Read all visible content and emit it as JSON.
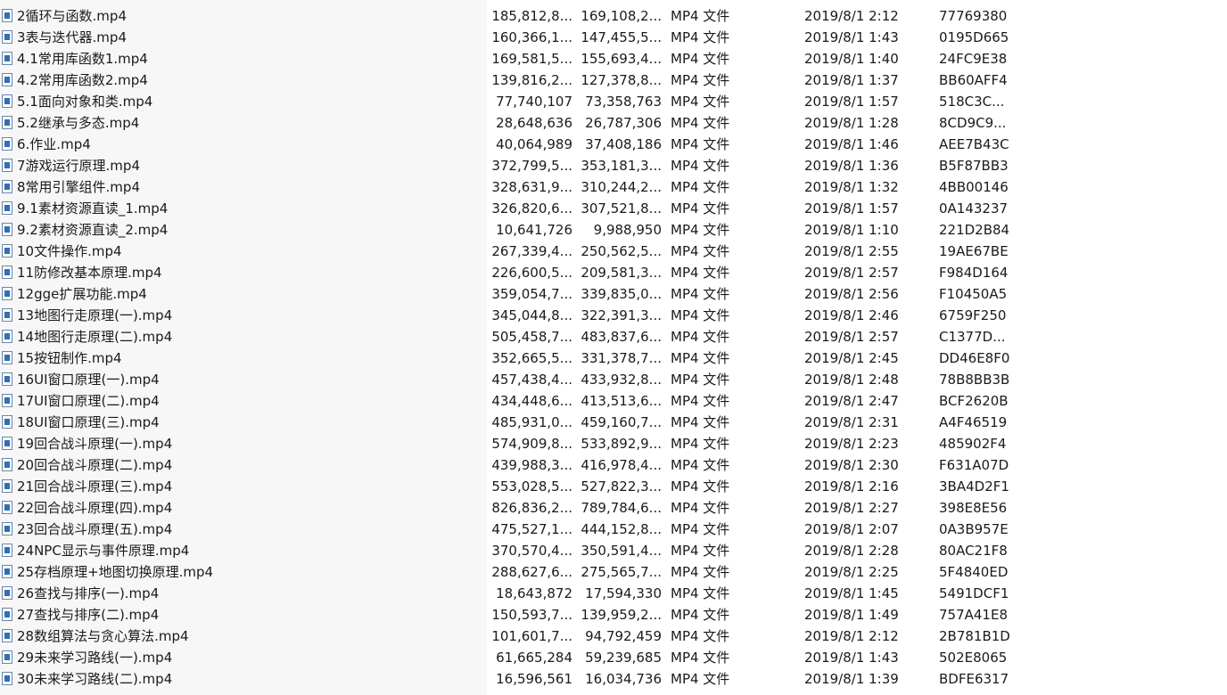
{
  "files": [
    {
      "name": "2循环与函数.mp4",
      "size": "185,812,8...",
      "packed": "169,108,2...",
      "type": "MP4 文件",
      "modified": "2019/8/1 2:12",
      "crc": "77769380"
    },
    {
      "name": "3表与迭代器.mp4",
      "size": "160,366,1...",
      "packed": "147,455,5...",
      "type": "MP4 文件",
      "modified": "2019/8/1 1:43",
      "crc": "0195D665"
    },
    {
      "name": "4.1常用库函数1.mp4",
      "size": "169,581,5...",
      "packed": "155,693,4...",
      "type": "MP4 文件",
      "modified": "2019/8/1 1:40",
      "crc": "24FC9E38"
    },
    {
      "name": "4.2常用库函数2.mp4",
      "size": "139,816,2...",
      "packed": "127,378,8...",
      "type": "MP4 文件",
      "modified": "2019/8/1 1:37",
      "crc": "BB60AFF4"
    },
    {
      "name": "5.1面向对象和类.mp4",
      "size": "77,740,107",
      "packed": "73,358,763",
      "type": "MP4 文件",
      "modified": "2019/8/1 1:57",
      "crc": "518C3C..."
    },
    {
      "name": "5.2继承与多态.mp4",
      "size": "28,648,636",
      "packed": "26,787,306",
      "type": "MP4 文件",
      "modified": "2019/8/1 1:28",
      "crc": "8CD9C9..."
    },
    {
      "name": "6.作业.mp4",
      "size": "40,064,989",
      "packed": "37,408,186",
      "type": "MP4 文件",
      "modified": "2019/8/1 1:46",
      "crc": "AEE7B43C"
    },
    {
      "name": "7游戏运行原理.mp4",
      "size": "372,799,5...",
      "packed": "353,181,3...",
      "type": "MP4 文件",
      "modified": "2019/8/1 1:36",
      "crc": "B5F87BB3"
    },
    {
      "name": "8常用引擎组件.mp4",
      "size": "328,631,9...",
      "packed": "310,244,2...",
      "type": "MP4 文件",
      "modified": "2019/8/1 1:32",
      "crc": "4BB00146"
    },
    {
      "name": "9.1素材资源直读_1.mp4",
      "size": "326,820,6...",
      "packed": "307,521,8...",
      "type": "MP4 文件",
      "modified": "2019/8/1 1:57",
      "crc": "0A143237"
    },
    {
      "name": "9.2素材资源直读_2.mp4",
      "size": "10,641,726",
      "packed": "9,988,950",
      "type": "MP4 文件",
      "modified": "2019/8/1 1:10",
      "crc": "221D2B84"
    },
    {
      "name": "10文件操作.mp4",
      "size": "267,339,4...",
      "packed": "250,562,5...",
      "type": "MP4 文件",
      "modified": "2019/8/1 2:55",
      "crc": "19AE67BE"
    },
    {
      "name": "11防修改基本原理.mp4",
      "size": "226,600,5...",
      "packed": "209,581,3...",
      "type": "MP4 文件",
      "modified": "2019/8/1 2:57",
      "crc": "F984D164"
    },
    {
      "name": "12gge扩展功能.mp4",
      "size": "359,054,7...",
      "packed": "339,835,0...",
      "type": "MP4 文件",
      "modified": "2019/8/1 2:56",
      "crc": "F10450A5"
    },
    {
      "name": "13地图行走原理(一).mp4",
      "size": "345,044,8...",
      "packed": "322,391,3...",
      "type": "MP4 文件",
      "modified": "2019/8/1 2:46",
      "crc": "6759F250"
    },
    {
      "name": "14地图行走原理(二).mp4",
      "size": "505,458,7...",
      "packed": "483,837,6...",
      "type": "MP4 文件",
      "modified": "2019/8/1 2:57",
      "crc": "C1377D..."
    },
    {
      "name": "15按钮制作.mp4",
      "size": "352,665,5...",
      "packed": "331,378,7...",
      "type": "MP4 文件",
      "modified": "2019/8/1 2:45",
      "crc": "DD46E8F0"
    },
    {
      "name": "16UI窗口原理(一).mp4",
      "size": "457,438,4...",
      "packed": "433,932,8...",
      "type": "MP4 文件",
      "modified": "2019/8/1 2:48",
      "crc": "78B8BB3B"
    },
    {
      "name": "17UI窗口原理(二).mp4",
      "size": "434,448,6...",
      "packed": "413,513,6...",
      "type": "MP4 文件",
      "modified": "2019/8/1 2:47",
      "crc": "BCF2620B"
    },
    {
      "name": "18UI窗口原理(三).mp4",
      "size": "485,931,0...",
      "packed": "459,160,7...",
      "type": "MP4 文件",
      "modified": "2019/8/1 2:31",
      "crc": "A4F46519"
    },
    {
      "name": "19回合战斗原理(一).mp4",
      "size": "574,909,8...",
      "packed": "533,892,9...",
      "type": "MP4 文件",
      "modified": "2019/8/1 2:23",
      "crc": "485902F4"
    },
    {
      "name": "20回合战斗原理(二).mp4",
      "size": "439,988,3...",
      "packed": "416,978,4...",
      "type": "MP4 文件",
      "modified": "2019/8/1 2:30",
      "crc": "F631A07D"
    },
    {
      "name": "21回合战斗原理(三).mp4",
      "size": "553,028,5...",
      "packed": "527,822,3...",
      "type": "MP4 文件",
      "modified": "2019/8/1 2:16",
      "crc": "3BA4D2F1"
    },
    {
      "name": "22回合战斗原理(四).mp4",
      "size": "826,836,2...",
      "packed": "789,784,6...",
      "type": "MP4 文件",
      "modified": "2019/8/1 2:27",
      "crc": "398E8E56"
    },
    {
      "name": "23回合战斗原理(五).mp4",
      "size": "475,527,1...",
      "packed": "444,152,8...",
      "type": "MP4 文件",
      "modified": "2019/8/1 2:07",
      "crc": "0A3B957E"
    },
    {
      "name": "24NPC显示与事件原理.mp4",
      "size": "370,570,4...",
      "packed": "350,591,4...",
      "type": "MP4 文件",
      "modified": "2019/8/1 2:28",
      "crc": "80AC21F8"
    },
    {
      "name": "25存档原理+地图切换原理.mp4",
      "size": "288,627,6...",
      "packed": "275,565,7...",
      "type": "MP4 文件",
      "modified": "2019/8/1 2:25",
      "crc": "5F4840ED"
    },
    {
      "name": "26查找与排序(一).mp4",
      "size": "18,643,872",
      "packed": "17,594,330",
      "type": "MP4 文件",
      "modified": "2019/8/1 1:45",
      "crc": "5491DCF1"
    },
    {
      "name": "27查找与排序(二).mp4",
      "size": "150,593,7...",
      "packed": "139,959,2...",
      "type": "MP4 文件",
      "modified": "2019/8/1 1:49",
      "crc": "757A41E8"
    },
    {
      "name": "28数组算法与贪心算法.mp4",
      "size": "101,601,7...",
      "packed": "94,792,459",
      "type": "MP4 文件",
      "modified": "2019/8/1 2:12",
      "crc": "2B781B1D"
    },
    {
      "name": "29未来学习路线(一).mp4",
      "size": "61,665,284",
      "packed": "59,239,685",
      "type": "MP4 文件",
      "modified": "2019/8/1 1:43",
      "crc": "502E8065"
    },
    {
      "name": "30未来学习路线(二).mp4",
      "size": "16,596,561",
      "packed": "16,034,736",
      "type": "MP4 文件",
      "modified": "2019/8/1 1:39",
      "crc": "BDFE6317"
    }
  ]
}
